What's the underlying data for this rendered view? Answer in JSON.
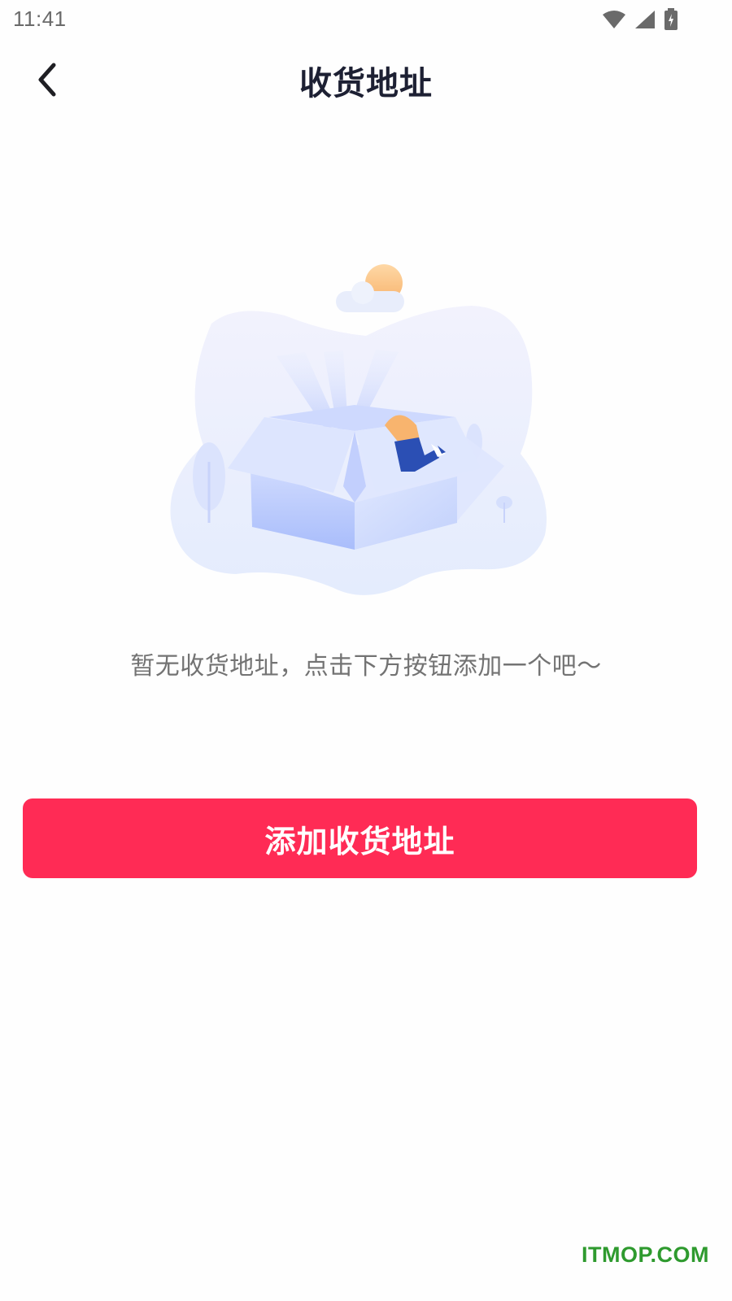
{
  "status_bar": {
    "time": "11:41",
    "icons": [
      "wifi-icon",
      "signal-icon",
      "battery-charging-icon"
    ]
  },
  "header": {
    "back_icon": "chevron-left-icon",
    "title": "收货地址"
  },
  "empty_state": {
    "illustration": "open-box-empty-illustration",
    "message": "暂无收货地址，点击下方按钮添加一个吧～"
  },
  "actions": {
    "add_address_label": "添加收货地址"
  },
  "watermark": {
    "text": "ITMOP.COM"
  },
  "colors": {
    "primary": "#ff2b55",
    "title": "#1d2033",
    "message": "#737373",
    "watermark": "#2e9a2e"
  }
}
